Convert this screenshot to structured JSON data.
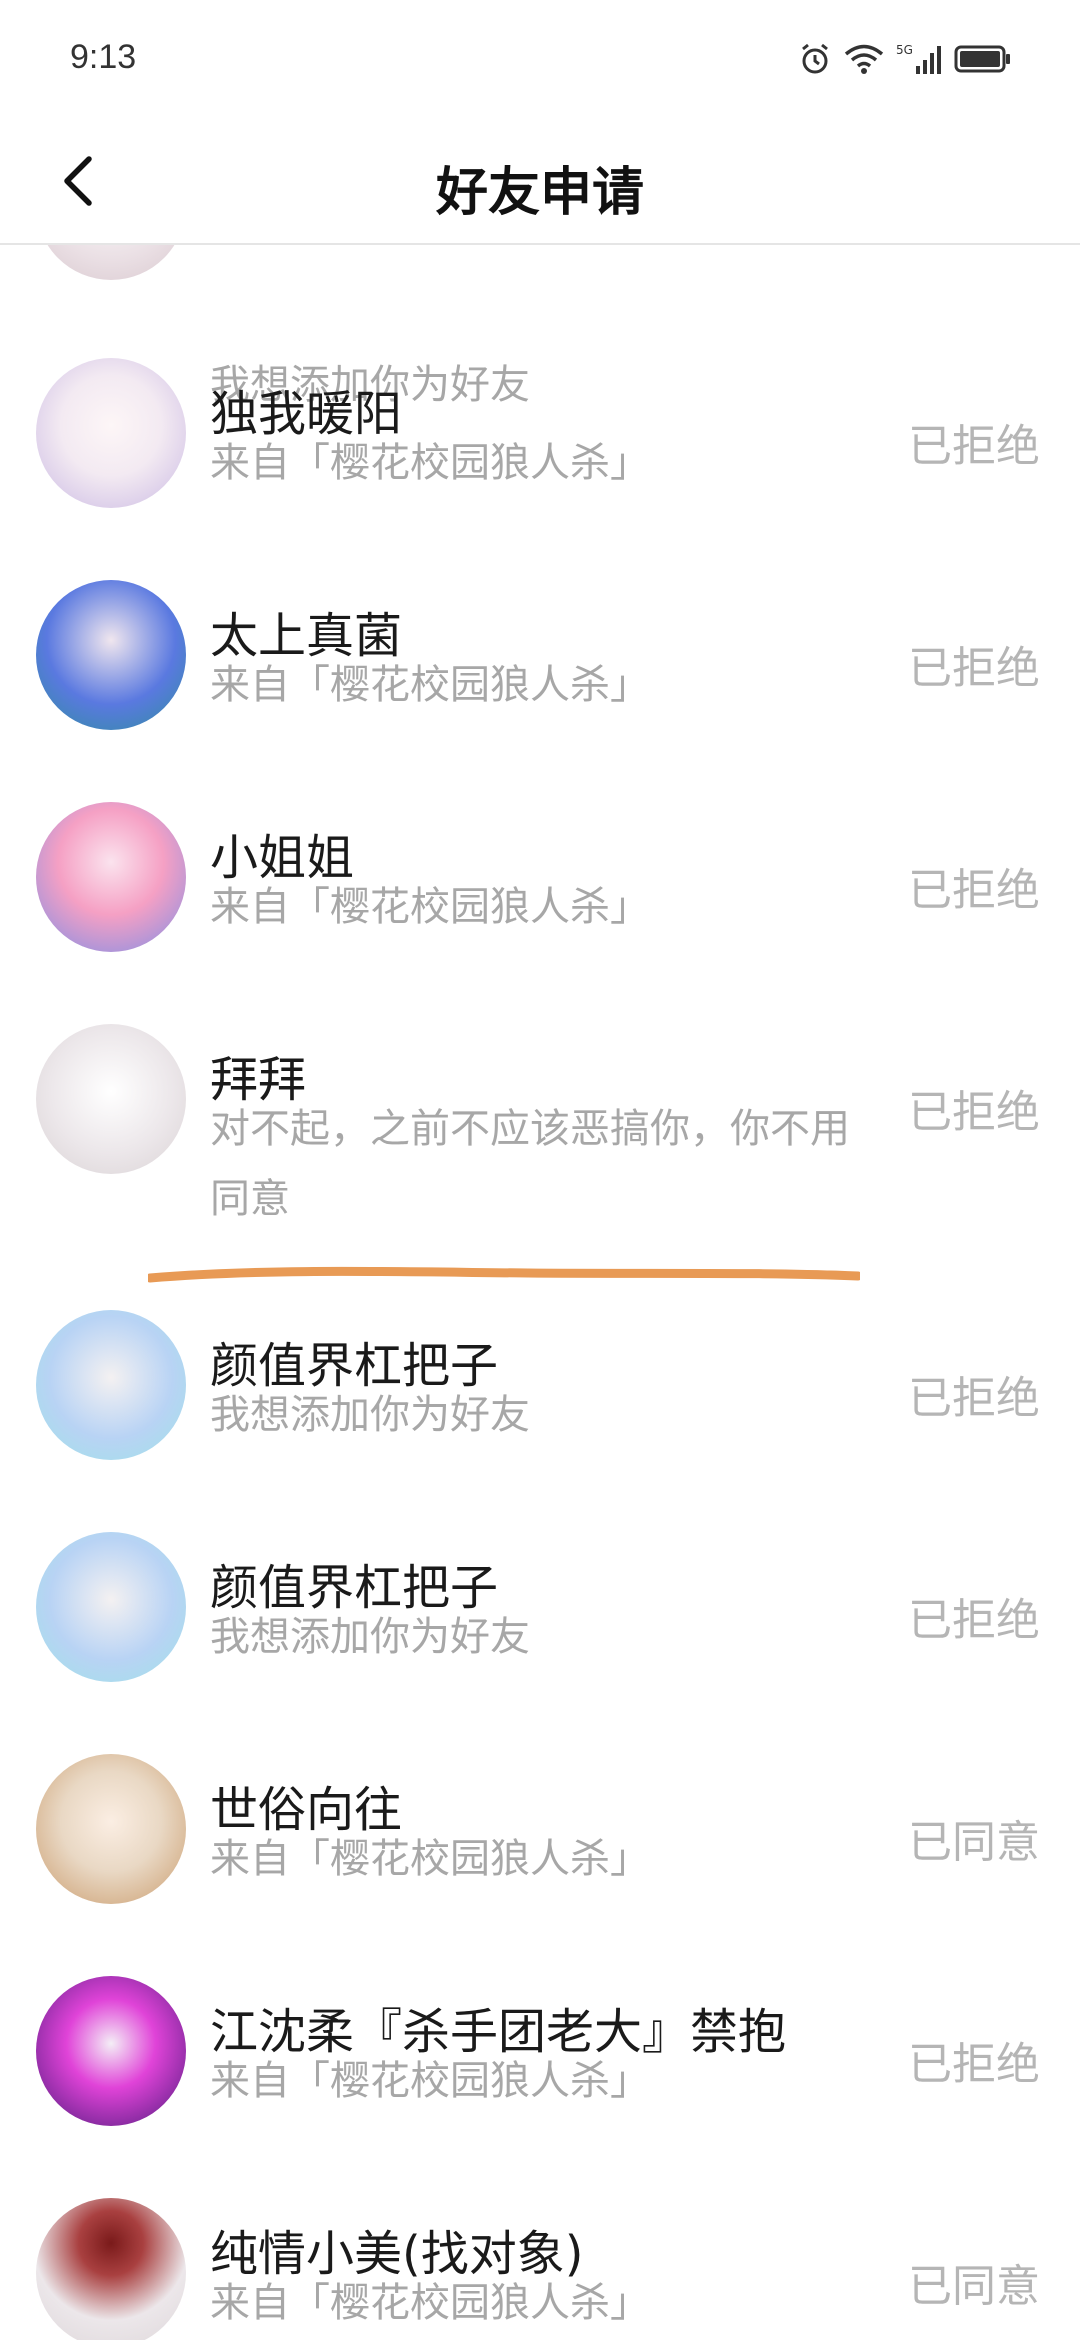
{
  "status_bar": {
    "time": "9:13",
    "icons": [
      "alarm-icon",
      "wifi-icon",
      "5g-signal-icon",
      "battery-icon"
    ]
  },
  "header": {
    "title": "好友申请",
    "back_icon": "back-icon"
  },
  "requests": [
    {
      "name": "",
      "message": "我想添加你为好友",
      "status": "",
      "avatar_colors": [
        "#eadfe4",
        "#ffffff"
      ]
    },
    {
      "name": "独我暖阳",
      "message": "来自「樱花校园狼人杀」",
      "status": "已拒绝",
      "avatar_colors": [
        "#f3eaf2",
        "#c9b8e3"
      ]
    },
    {
      "name": "太上真菌",
      "message": "来自「樱花校园狼人杀」",
      "status": "已拒绝",
      "avatar_colors": [
        "#5a79e0",
        "#2e8f9c"
      ]
    },
    {
      "name": "小姐姐",
      "message": "来自「樱花校园狼人杀」",
      "status": "已拒绝",
      "avatar_colors": [
        "#7d8de6",
        "#f5a0c4"
      ]
    },
    {
      "name": "拜拜",
      "message": "对不起，之前不应该恶搞你，你不用同意",
      "status": "已拒绝",
      "avatar_colors": [
        "#ece7ea",
        "#d9d2d4"
      ]
    },
    {
      "name": "颜值界杠把子",
      "message": "我想添加你为好友",
      "status": "已拒绝",
      "avatar_colors": [
        "#b8d3f4",
        "#9fe3e7"
      ]
    },
    {
      "name": "颜值界杠把子",
      "message": "我想添加你为好友",
      "status": "已拒绝",
      "avatar_colors": [
        "#b8d3f4",
        "#9fe3e7"
      ]
    },
    {
      "name": "世俗向往",
      "message": "来自「樱花校园狼人杀」",
      "status": "已同意",
      "avatar_colors": [
        "#e9d8c4",
        "#c99a6a"
      ]
    },
    {
      "name": "江沈柔『杀手团老大』禁抱",
      "message": "来自「樱花校园狼人杀」",
      "status": "已拒绝",
      "avatar_colors": [
        "#4a1a7a",
        "#e043d8"
      ]
    },
    {
      "name": "纯情小美(找对象)",
      "message": "来自「樱花校园狼人杀」",
      "status": "已同意",
      "avatar_colors": [
        "#ece7ea",
        "#7a1a1a"
      ]
    }
  ],
  "colors": {
    "highlight_underline": "#e89a55",
    "status_text": "#b5b5b5",
    "secondary_text": "#a7a7a7"
  }
}
